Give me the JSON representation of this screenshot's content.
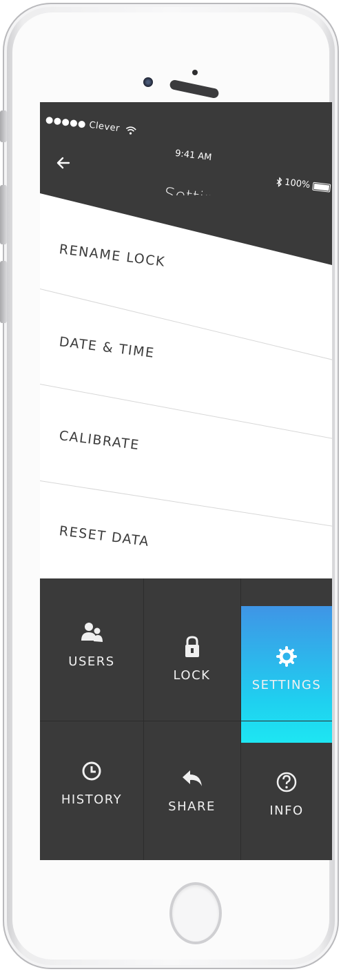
{
  "status_bar": {
    "carrier": "●●●●● Clever",
    "time": "9:41 AM",
    "battery": "100%"
  },
  "header": {
    "title": "Settings"
  },
  "menu_items": [
    {
      "label": "RENAME LOCK"
    },
    {
      "label": "DATE & TIME"
    },
    {
      "label": "CALIBRATE"
    },
    {
      "label": "RESET DATA"
    }
  ],
  "tiles": [
    {
      "label": "USERS",
      "icon": "users-icon"
    },
    {
      "label": "LOCK",
      "icon": "lock-icon"
    },
    {
      "label": "SETTINGS",
      "icon": "gear-icon",
      "active": true
    },
    {
      "label": "HISTORY",
      "icon": "clock-icon"
    },
    {
      "label": "SHARE",
      "icon": "share-icon"
    },
    {
      "label": "INFO",
      "icon": "question-icon"
    }
  ],
  "colors": {
    "dark_bg": "#3a3a3a",
    "accent_top": "#3f95e6",
    "accent_bottom": "#1ee6f2"
  }
}
